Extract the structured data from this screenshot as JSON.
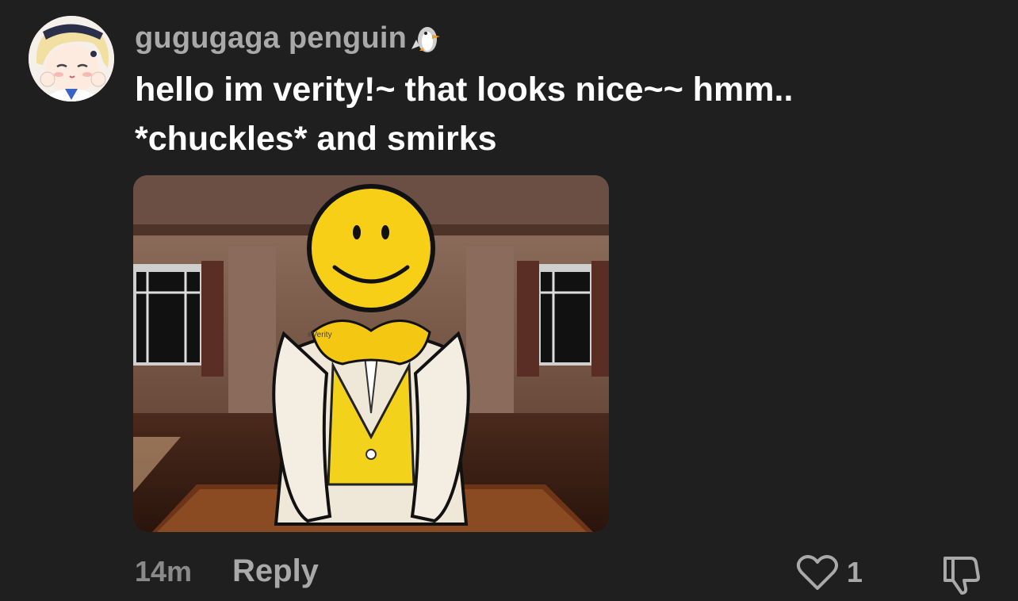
{
  "comment": {
    "username": "gugugaga penguin",
    "username_icon": "penguin-icon",
    "text_lines": [
      "hello im verity!~ that looks nice~~ hmm..",
      "*chuckles* and smirks"
    ],
    "attached_image": {
      "description_icon": "smiley-face-character-image",
      "watermark": "#Verity"
    },
    "timestamp": "14m",
    "reply_label": "Reply",
    "like_count": "1"
  },
  "colors": {
    "background": "#1f1f1f",
    "username": "#a9a9a9",
    "text": "#ffffff",
    "meta": "#8a8a8a"
  }
}
